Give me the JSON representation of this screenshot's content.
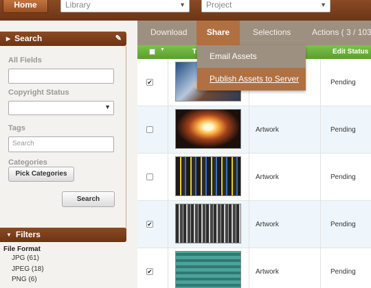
{
  "topbar": {
    "home_label": "Home",
    "library_placeholder": "Library",
    "project_placeholder": "Project"
  },
  "search_panel": {
    "title": "Search",
    "all_fields_label": "All Fields",
    "all_fields_value": "",
    "copyright_label": "Copyright Status",
    "copyright_value": "",
    "tags_label": "Tags",
    "tags_placeholder": "Search",
    "categories_label": "Categories",
    "pick_categories_label": "Pick Categories",
    "search_button_label": "Search"
  },
  "filters_panel": {
    "title": "Filters",
    "file_format_label": "File Format",
    "file_formats": [
      "JPG (61)",
      "JPEG (18)",
      "PNG (6)"
    ]
  },
  "tabs": [
    "Download",
    "Share",
    "Selections",
    "Actions ( 3 / 103"
  ],
  "active_tab": "Share",
  "share_menu": [
    "Email Assets",
    "Publish Assets to Server"
  ],
  "table": {
    "header_col2": "T",
    "header_edit_status": "Edit Status",
    "rows": [
      {
        "checked": true,
        "category": "",
        "status": "Pending"
      },
      {
        "checked": false,
        "category": "Artwork",
        "status": "Pending"
      },
      {
        "checked": false,
        "category": "Artwork",
        "status": "Pending"
      },
      {
        "checked": true,
        "category": "Artwork",
        "status": "Pending"
      },
      {
        "checked": true,
        "category": "Artwork",
        "status": "Pending"
      }
    ]
  }
}
